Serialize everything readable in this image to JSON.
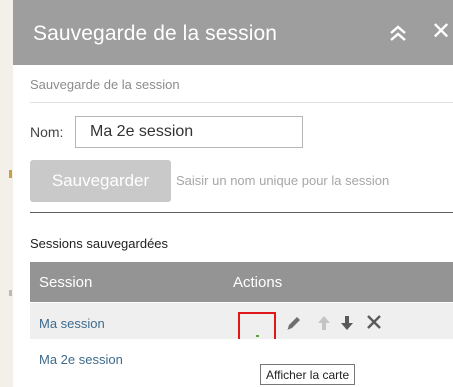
{
  "header": {
    "title": "Sauvegarde de la session",
    "close_glyph": "✕",
    "collapse_icon": "double-chevron-up-icon"
  },
  "form": {
    "subtitle": "Sauvegarde de la session",
    "name_label": "Nom:",
    "name_value": "Ma 2e session",
    "save_label": "Sauvegarder",
    "save_hint": "Saisir un nom unique pour la session"
  },
  "sessions": {
    "title": "Sessions sauvegardées",
    "columns": [
      "Session",
      "Actions"
    ],
    "rows": [
      {
        "name": "Ma session",
        "actions": [
          "show-map-icon",
          "pencil-icon",
          "arrow-up-icon",
          "arrow-down-icon",
          "close-icon"
        ]
      },
      {
        "name": "Ma 2e session"
      }
    ]
  },
  "tooltip": {
    "text": "Afficher la carte"
  },
  "colors": {
    "header": "#9e9e9e",
    "table_header": "#949494",
    "highlight_box": "#e0161b",
    "link": "#3d6b8c"
  }
}
